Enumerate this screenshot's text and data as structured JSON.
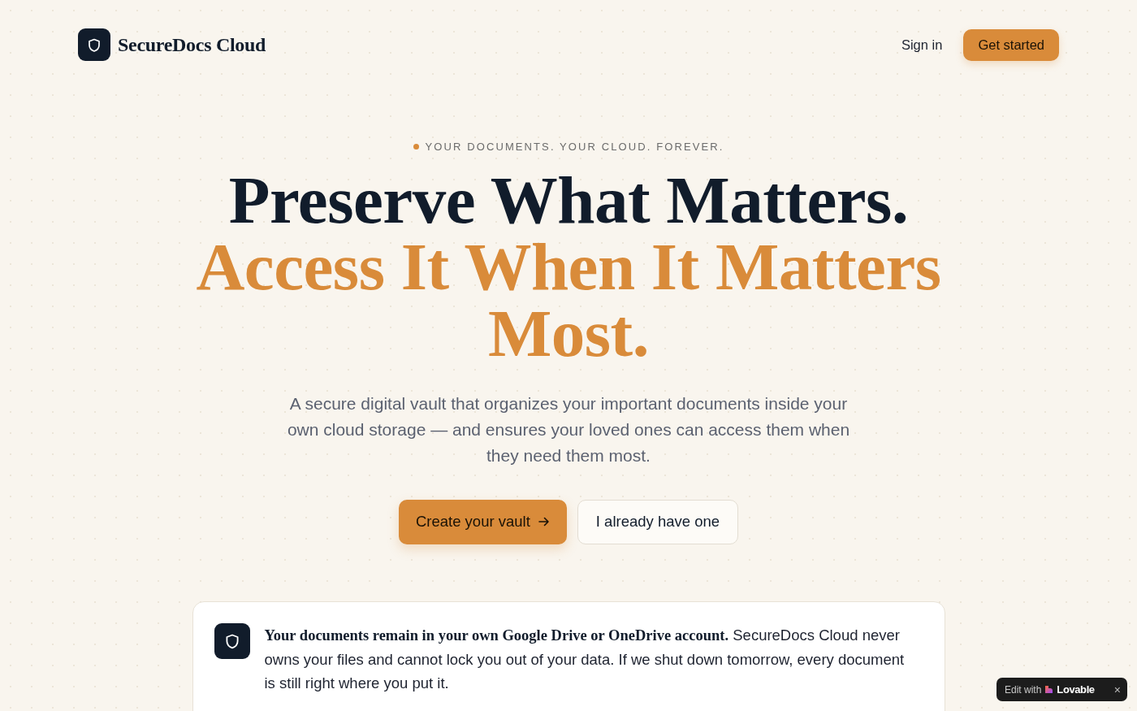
{
  "header": {
    "brand": "SecureDocs Cloud",
    "nav": [
      {
        "label": "Sign in",
        "kind": "link"
      },
      {
        "label": "Get started",
        "kind": "primary"
      }
    ]
  },
  "hero": {
    "eyebrow": "YOUR DOCUMENTS. YOUR CLOUD. FOREVER.",
    "title_lines": [
      {
        "text": "Preserve What Matters.",
        "accent": false
      },
      {
        "text": "Access It When It Matters Most.",
        "accent": true
      }
    ],
    "subtitle": "A secure digital vault that organizes your important documents inside your own cloud storage — and ensures your loved ones can access them when they need them most.",
    "actions": [
      {
        "label": "Create your vault",
        "kind": "primary"
      },
      {
        "label": "I already have one",
        "kind": "secondary"
      }
    ]
  },
  "notice": {
    "text": "**Your documents remain in your own Google Drive or OneDrive account.** SecureDocs Cloud never owns your files and cannot lock you out of your data. If we shut down tomorrow, every document is still right where you put it."
  },
  "badge": {
    "prefix": "Edit with",
    "brand": "Lovable",
    "close": "×"
  }
}
